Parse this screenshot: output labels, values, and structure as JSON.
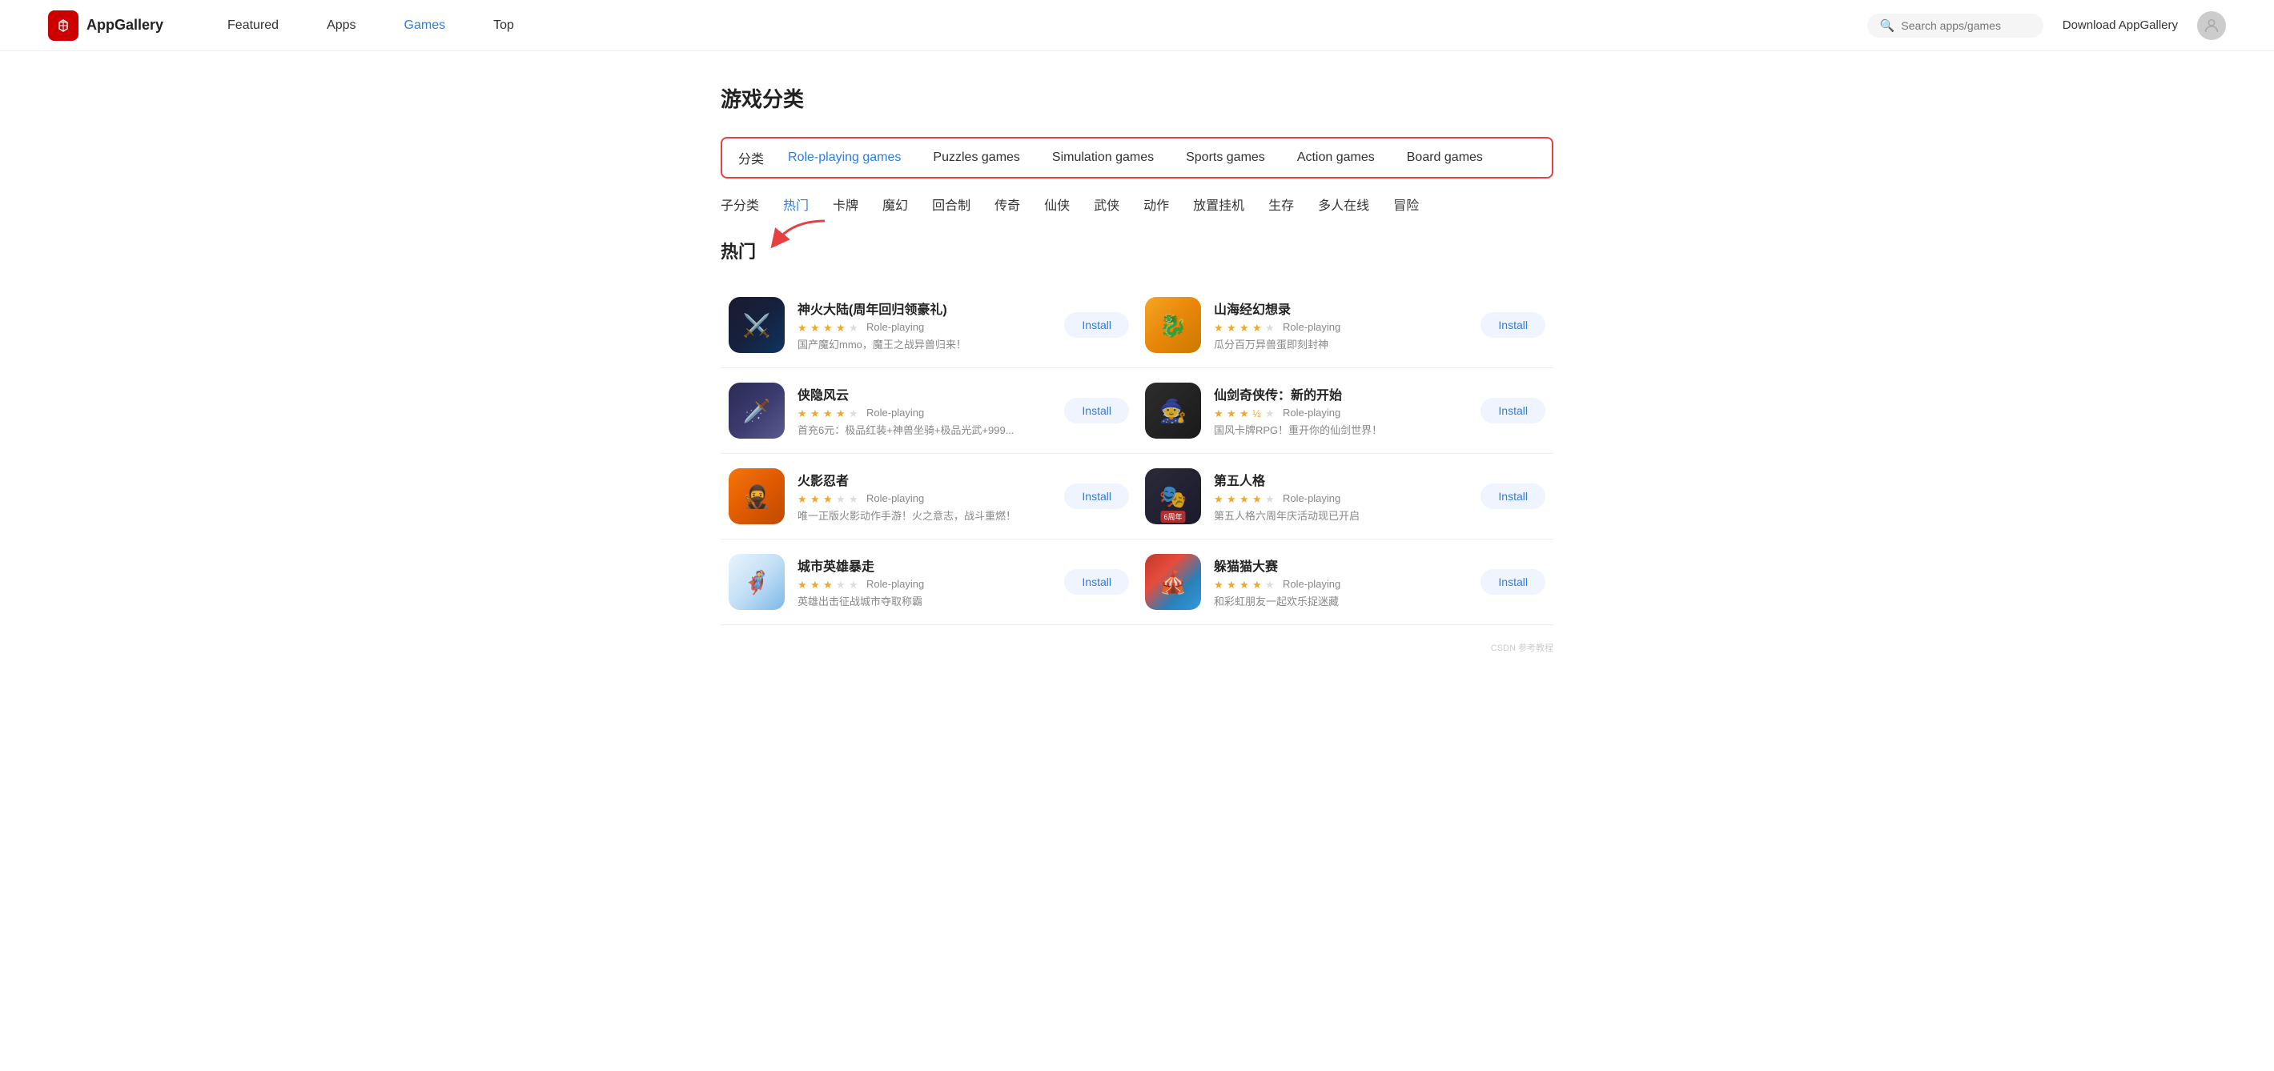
{
  "header": {
    "logo_text": "AppGallery",
    "nav_items": [
      {
        "label": "Featured",
        "active": false
      },
      {
        "label": "Apps",
        "active": false
      },
      {
        "label": "Games",
        "active": true
      },
      {
        "label": "Top",
        "active": false
      }
    ],
    "search_placeholder": "Search apps/games",
    "download_label": "Download AppGallery"
  },
  "page": {
    "title": "游戏分类",
    "category_label": "分类",
    "categories": [
      {
        "label": "Role-playing games",
        "active": true
      },
      {
        "label": "Puzzles games",
        "active": false
      },
      {
        "label": "Simulation games",
        "active": false
      },
      {
        "label": "Sports games",
        "active": false
      },
      {
        "label": "Action games",
        "active": false
      },
      {
        "label": "Board games",
        "active": false
      }
    ],
    "subcategory_label": "子分类",
    "subcategories": [
      {
        "label": "热门",
        "active": true
      },
      {
        "label": "卡牌",
        "active": false
      },
      {
        "label": "魔幻",
        "active": false
      },
      {
        "label": "回合制",
        "active": false
      },
      {
        "label": "传奇",
        "active": false
      },
      {
        "label": "仙侠",
        "active": false
      },
      {
        "label": "武侠",
        "active": false
      },
      {
        "label": "动作",
        "active": false
      },
      {
        "label": "放置挂机",
        "active": false
      },
      {
        "label": "生存",
        "active": false
      },
      {
        "label": "多人在线",
        "active": false
      },
      {
        "label": "冒险",
        "active": false
      }
    ],
    "section_title": "热门",
    "apps": [
      {
        "name": "神火大陆(周年回归领豪礼)",
        "stars": 4,
        "max_stars": 5,
        "category": "Role-playing",
        "desc": "国产魔幻mmo，魔王之战异兽归来！",
        "install_label": "Install",
        "icon_class": "icon-1",
        "icon_emoji": "⚔️"
      },
      {
        "name": "山海经幻想录",
        "stars": 4,
        "max_stars": 5,
        "category": "Role-playing",
        "desc": "瓜分百万异兽蛋即刻封神",
        "install_label": "Install",
        "icon_class": "icon-2",
        "icon_emoji": "🐉"
      },
      {
        "name": "侠隐风云",
        "stars": 4,
        "max_stars": 5,
        "category": "Role-playing",
        "desc": "首充6元：极品红装+神兽坐骑+极品光武+999...",
        "install_label": "Install",
        "icon_class": "icon-3",
        "icon_emoji": "🗡️"
      },
      {
        "name": "仙剑奇侠传：新的开始",
        "stars": 3.5,
        "max_stars": 5,
        "category": "Role-playing",
        "desc": "国风卡牌RPG！重开你的仙剑世界！",
        "install_label": "Install",
        "icon_class": "icon-4",
        "icon_emoji": "🧙"
      },
      {
        "name": "火影忍者",
        "stars": 3,
        "max_stars": 5,
        "category": "Role-playing",
        "desc": "唯一正版火影动作手游！火之意志，战斗重燃！",
        "install_label": "Install",
        "icon_class": "icon-5",
        "icon_emoji": "🥷"
      },
      {
        "name": "第五人格",
        "stars": 4,
        "max_stars": 5,
        "category": "Role-playing",
        "desc": "第五人格六周年庆活动现已开启",
        "install_label": "Install",
        "icon_class": "icon-6",
        "icon_emoji": "🎭",
        "badge": "6周年"
      },
      {
        "name": "城市英雄暴走",
        "stars": 3,
        "max_stars": 5,
        "category": "Role-playing",
        "desc": "英雄出击征战城市夺取称霸",
        "install_label": "Install",
        "icon_class": "icon-7",
        "icon_emoji": "🦸"
      },
      {
        "name": "躲猫猫大赛",
        "stars": 4,
        "max_stars": 5,
        "category": "Role-playing",
        "desc": "和彩虹朋友一起欢乐捉迷藏",
        "install_label": "Install",
        "icon_class": "icon-8",
        "icon_emoji": "🎪"
      }
    ]
  },
  "footer": {
    "note": "CSDN 参考教程"
  }
}
